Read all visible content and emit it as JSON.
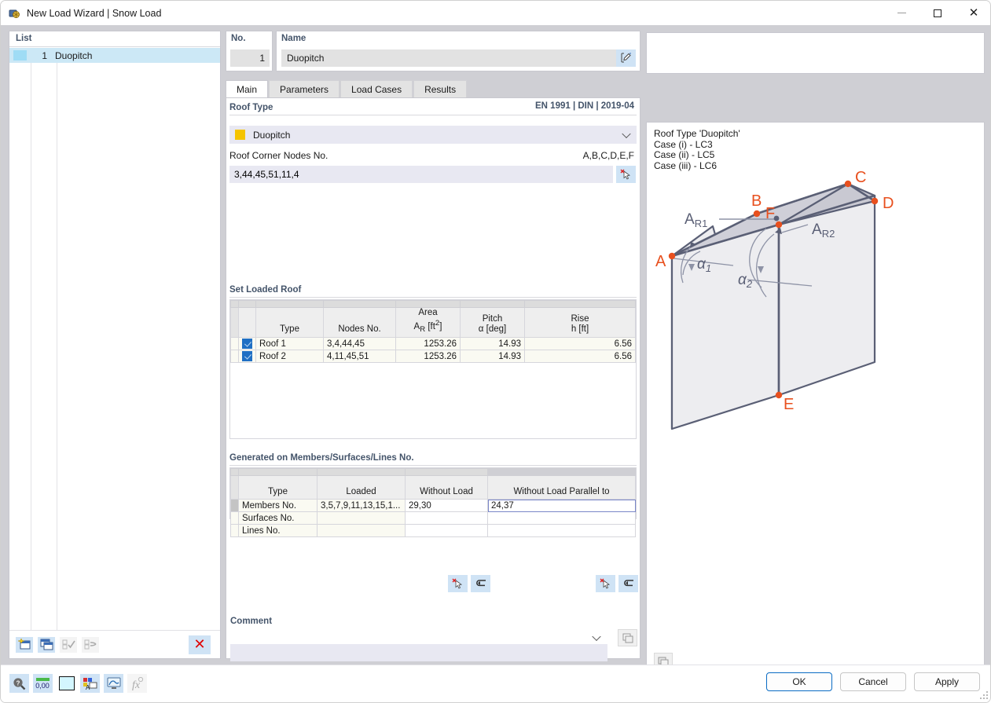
{
  "window": {
    "title": "New Load Wizard | Snow Load",
    "title_icon": "snow-load-wizard-icon",
    "minimize": "minimize-icon",
    "maximize": "maximize-icon",
    "close": "close-icon"
  },
  "list_panel": {
    "header": "List",
    "items": [
      {
        "num": "1",
        "name": "Duopitch",
        "swatch": "#9fdcf5"
      }
    ],
    "toolbar": [
      {
        "name": "new-item-button",
        "icon": "new-window-star-icon",
        "enabled": true
      },
      {
        "name": "copy-item-button",
        "icon": "copy-window-icon",
        "enabled": true
      },
      {
        "name": "select-all-button",
        "icon": "checklist-check-icon",
        "enabled": false
      },
      {
        "name": "invert-selection-button",
        "icon": "checklist-swap-icon",
        "enabled": false
      },
      {
        "name": "delete-item-button",
        "icon": "red-x-icon",
        "enabled": true,
        "label": "✕"
      }
    ]
  },
  "fields": {
    "no_label": "No.",
    "no_value": "1",
    "name_label": "Name",
    "name_value": "Duopitch",
    "name_edit_icon": "edit-pencil-icon"
  },
  "tabs": [
    {
      "label": "Main",
      "active": true
    },
    {
      "label": "Parameters",
      "active": false
    },
    {
      "label": "Load Cases",
      "active": false
    },
    {
      "label": "Results",
      "active": false
    }
  ],
  "roof_type": {
    "group_title": "Roof Type",
    "standard": "EN 1991 | DIN | 2019-04",
    "selected": "Duopitch",
    "swatch_color": "#f5c400",
    "chevron_icon": "chevron-down-icon",
    "nodes_label": "Roof Corner Nodes No.",
    "nodes_hint": "A,B,C,D,E,F",
    "nodes_value": "3,44,45,51,11,4",
    "pick_icon": "pick-cursor-icon"
  },
  "set_loaded_roof": {
    "group_title": "Set Loaded Roof",
    "columns": [
      {
        "line1": "",
        "line2": "Type"
      },
      {
        "line1": "",
        "line2": "Nodes No."
      },
      {
        "line1": "Area",
        "line2": "AR [ft²]"
      },
      {
        "line1": "Pitch",
        "line2": "α [deg]"
      },
      {
        "line1": "Rise",
        "line2": "h [ft]"
      }
    ],
    "rows": [
      {
        "checked": true,
        "type": "Roof 1",
        "nodes": "3,4,44,45",
        "area": "1253.26",
        "pitch": "14.93",
        "rise": "6.56"
      },
      {
        "checked": true,
        "type": "Roof 2",
        "nodes": "4,11,45,51",
        "area": "1253.26",
        "pitch": "14.93",
        "rise": "6.56"
      }
    ]
  },
  "generated_on": {
    "group_title": "Generated on Members/Surfaces/Lines No.",
    "columns": [
      "Type",
      "Loaded",
      "Without Load",
      "Without Load Parallel to"
    ],
    "rows": [
      {
        "type": "Members No.",
        "loaded": "3,5,7,9,11,13,15,1...",
        "without_load": "29,30",
        "parallel": "24,37",
        "focused": true
      },
      {
        "type": "Surfaces No.",
        "loaded": "",
        "without_load": "",
        "parallel": "",
        "focused": false
      },
      {
        "type": "Lines No.",
        "loaded": "",
        "without_load": "",
        "parallel": "",
        "focused": false
      }
    ],
    "buttons": [
      {
        "name": "pick-members-button",
        "icon": "pick-cursor-icon"
      },
      {
        "name": "reset-members-button",
        "icon": "undo-arrow-icon"
      },
      {
        "name": "pick-parallel-button",
        "icon": "pick-cursor-icon"
      },
      {
        "name": "reset-parallel-button",
        "icon": "undo-arrow-icon"
      }
    ]
  },
  "comment": {
    "label": "Comment",
    "value": "",
    "chevron_icon": "chevron-down-icon",
    "button_icon": "comment-library-icon"
  },
  "info_panel": {
    "lines": [
      "Roof Type 'Duopitch'",
      "Case (i) - LC3",
      "Case (ii) - LC5",
      "Case (iii) - LC6"
    ],
    "footer_button_icon": "image-export-icon"
  },
  "diagram": {
    "name": "duopitch-roof-diagram",
    "vertex_labels": [
      "A",
      "B",
      "C",
      "D",
      "E",
      "F"
    ],
    "area_labels": [
      "A",
      "A"
    ],
    "area_sub": [
      "R1",
      "R2"
    ],
    "angle_labels": [
      "α",
      "α"
    ],
    "angle_sub": [
      "1",
      "2"
    ],
    "colors": {
      "vertex": "#e8501e",
      "edge": "#5a5f75",
      "wall_fill": "#ededf0",
      "roof_fill": "#c9c9d2",
      "label_text": "#5a5f75"
    }
  },
  "footer": {
    "tools": [
      {
        "name": "info-magnifier-button",
        "icon": "magnifier-question-icon",
        "enabled": true
      },
      {
        "name": "units-button",
        "icon": "number-units-icon",
        "enabled": true
      },
      {
        "name": "color-button",
        "icon": "color-swatch-icon",
        "enabled": true
      },
      {
        "name": "display-properties-button",
        "icon": "display-props-icon",
        "enabled": true
      },
      {
        "name": "graphic-settings-button",
        "icon": "monitor-settings-icon",
        "enabled": true
      },
      {
        "name": "formula-button",
        "icon": "function-fx-icon",
        "enabled": false
      }
    ],
    "buttons": [
      {
        "label": "OK",
        "primary": true,
        "name": "ok-button"
      },
      {
        "label": "Cancel",
        "primary": false,
        "name": "cancel-button"
      },
      {
        "label": "Apply",
        "primary": false,
        "name": "apply-button"
      }
    ]
  }
}
